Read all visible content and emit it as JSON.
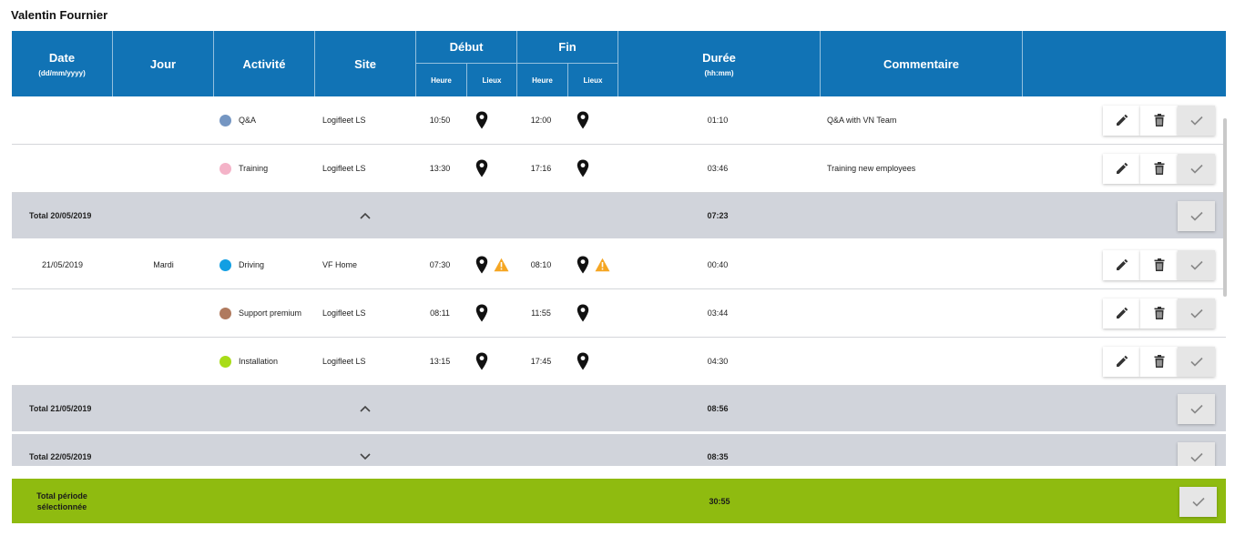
{
  "user": {
    "name": "Valentin Fournier"
  },
  "header": {
    "date": "Date",
    "date_format": "(dd/mm/yyyy)",
    "jour": "Jour",
    "activite": "Activité",
    "site": "Site",
    "debut": "Début",
    "fin": "Fin",
    "heure": "Heure",
    "lieux": "Lieux",
    "duree": "Durée",
    "duree_format": "(hh:mm)",
    "commentaire": "Commentaire"
  },
  "rows": [
    {
      "type": "entry",
      "date": "",
      "jour": "",
      "activity": "Q&A",
      "color": "#7596c2",
      "site": "Logifleet LS",
      "start": "10:50",
      "start_warn": false,
      "end": "12:00",
      "end_warn": false,
      "duration": "01:10",
      "comment": "Q&A with VN Team"
    },
    {
      "type": "entry",
      "date": "",
      "jour": "",
      "activity": "Training",
      "color": "#f4b3c8",
      "site": "Logifleet LS",
      "start": "13:30",
      "start_warn": false,
      "end": "17:16",
      "end_warn": false,
      "duration": "03:46",
      "comment": "Training new employees"
    },
    {
      "type": "total",
      "label": "Total 20/05/2019",
      "chevron": "up",
      "duration": "07:23"
    },
    {
      "type": "entry",
      "date": "21/05/2019",
      "jour": "Mardi",
      "activity": "Driving",
      "color": "#129fe3",
      "site": "VF Home",
      "start": "07:30",
      "start_warn": true,
      "end": "08:10",
      "end_warn": true,
      "duration": "00:40",
      "comment": ""
    },
    {
      "type": "entry",
      "date": "",
      "jour": "",
      "activity": "Support premium",
      "color": "#b07a5e",
      "site": "Logifleet LS",
      "start": "08:11",
      "start_warn": false,
      "end": "11:55",
      "end_warn": false,
      "duration": "03:44",
      "comment": ""
    },
    {
      "type": "entry",
      "date": "",
      "jour": "",
      "activity": "Installation",
      "color": "#a8dc18",
      "site": "Logifleet LS",
      "start": "13:15",
      "start_warn": false,
      "end": "17:45",
      "end_warn": false,
      "duration": "04:30",
      "comment": ""
    },
    {
      "type": "total",
      "label": "Total 21/05/2019",
      "chevron": "up",
      "duration": "08:56"
    },
    {
      "type": "total",
      "label": "Total 22/05/2019",
      "chevron": "down",
      "duration": "08:35"
    }
  ],
  "footer": {
    "label": "Total période sélectionnée",
    "duration": "30:55"
  },
  "colors": {
    "header_bg": "#1173b5",
    "total_bg": "#d1d4db",
    "footer_bg": "#8fbb10",
    "warning": "#f5a623"
  },
  "icons": {
    "location": "map-pin-icon",
    "warning": "warning-icon",
    "edit": "pencil-icon",
    "delete": "trash-icon",
    "validate": "check-icon"
  }
}
